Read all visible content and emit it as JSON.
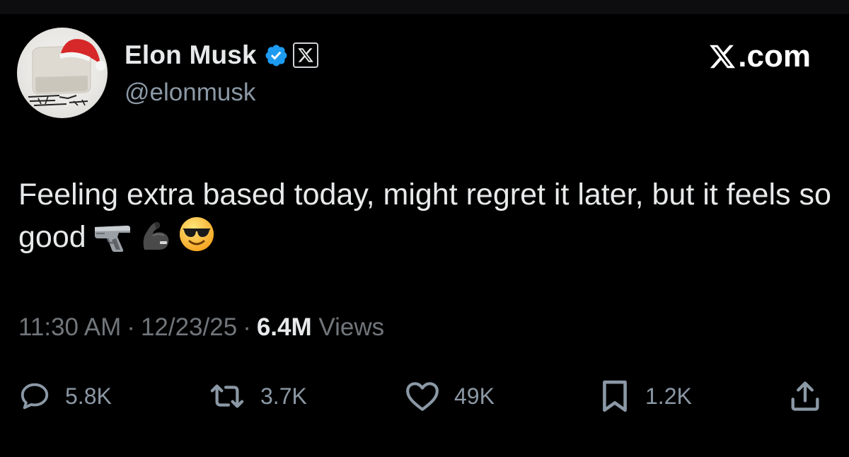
{
  "header": {
    "display_name": "Elon Musk",
    "handle": "@elonmusk",
    "brand": "X.com",
    "verified_badge_color": "#1d9bf0"
  },
  "tweet": {
    "text": "Feeling extra based today, might regret it later, but it feels so good",
    "emojis": [
      "pistol-emoji",
      "flexed-biceps-emoji",
      "sunglasses-face-emoji"
    ]
  },
  "meta": {
    "time": "11:30 AM",
    "separator": "·",
    "date": "12/23/25",
    "views_count": "6.4M",
    "views_label": "Views"
  },
  "actions": {
    "replies": "5.8K",
    "reposts": "3.7K",
    "likes": "49K",
    "bookmarks": "1.2K"
  },
  "icons": [
    "reply-icon",
    "repost-icon",
    "like-icon",
    "bookmark-icon",
    "share-icon",
    "verified-badge-icon",
    "x-logo-icon"
  ],
  "colors": {
    "background": "#000000",
    "text_primary": "#e7e9ea",
    "text_secondary": "#71767b",
    "accent": "#1d9bf0"
  }
}
